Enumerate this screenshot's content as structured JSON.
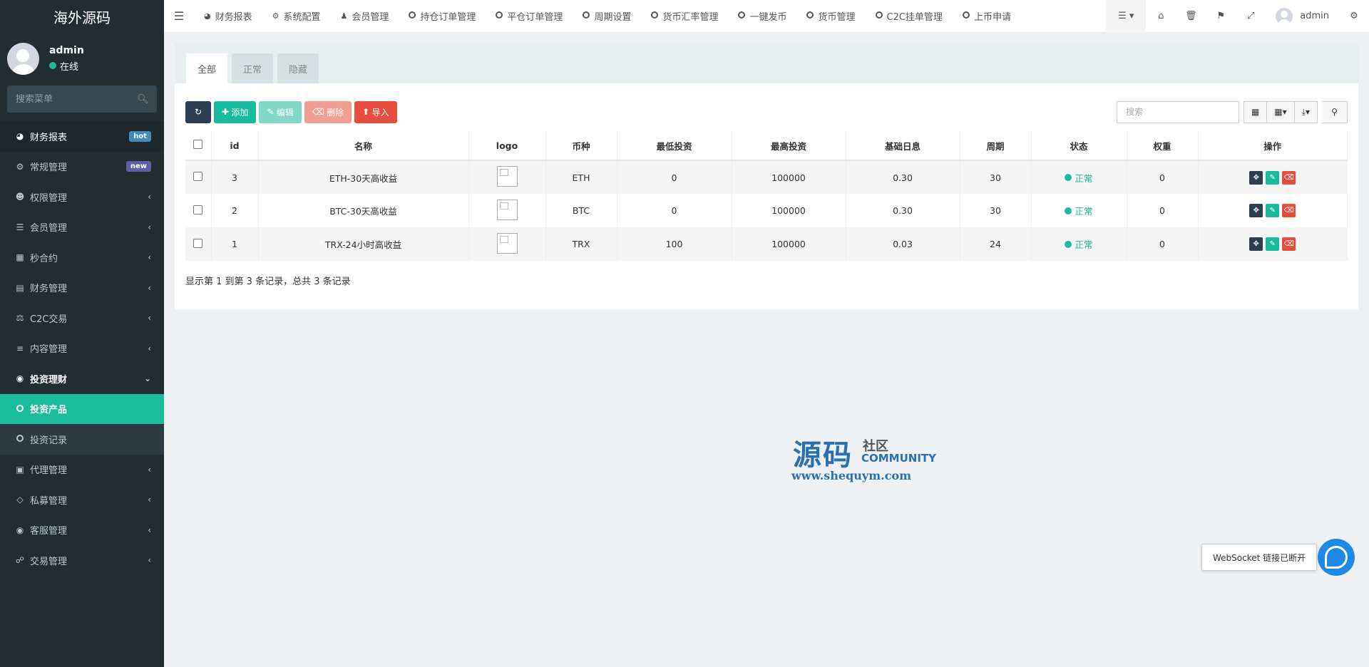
{
  "sidebar": {
    "brand": "海外源码",
    "user": {
      "name": "admin",
      "status": "在线"
    },
    "search_placeholder": "搜索菜单",
    "items": [
      {
        "label": "财务报表",
        "badge": "hot"
      },
      {
        "label": "常规管理",
        "badge": "new"
      },
      {
        "label": "权限管理"
      },
      {
        "label": "会员管理"
      },
      {
        "label": "秒合约"
      },
      {
        "label": "财务管理"
      },
      {
        "label": "C2C交易"
      },
      {
        "label": "内容管理"
      },
      {
        "label": "投资理财"
      },
      {
        "label": "投资产品"
      },
      {
        "label": "投资记录"
      },
      {
        "label": "代理管理"
      },
      {
        "label": "私募管理"
      },
      {
        "label": "客服管理"
      },
      {
        "label": "交易管理"
      }
    ]
  },
  "topbar": {
    "links": [
      "财务报表",
      "系统配置",
      "会员管理",
      "持仓订单管理",
      "平仓订单管理",
      "周期设置",
      "货币汇率管理",
      "一键发币",
      "货币管理",
      "C2C挂单管理",
      "上币申请"
    ],
    "user": "admin"
  },
  "tabs": [
    "全部",
    "正常",
    "隐藏"
  ],
  "toolbar": {
    "add": "添加",
    "edit": "编辑",
    "delete": "删除",
    "import": "导入",
    "search_placeholder": "搜索"
  },
  "table": {
    "headers": [
      "id",
      "名称",
      "logo",
      "币种",
      "最低投资",
      "最高投资",
      "基础日息",
      "周期",
      "状态",
      "权重",
      "操作"
    ],
    "rows": [
      {
        "id": "3",
        "name": "ETH-30天高收益",
        "coin": "ETH",
        "min": "0",
        "max": "100000",
        "rate": "0.30",
        "period": "30",
        "status": "正常",
        "weight": "0"
      },
      {
        "id": "2",
        "name": "BTC-30天高收益",
        "coin": "BTC",
        "min": "0",
        "max": "100000",
        "rate": "0.30",
        "period": "30",
        "status": "正常",
        "weight": "0"
      },
      {
        "id": "1",
        "name": "TRX-24小时高收益",
        "coin": "TRX",
        "min": "100",
        "max": "100000",
        "rate": "0.03",
        "period": "24",
        "status": "正常",
        "weight": "0"
      }
    ]
  },
  "pagination_info": "显示第 1 到第 3 条记录，总共 3 条记录",
  "watermark": {
    "main": "源码",
    "sub1": "社区",
    "sub2": "COMMUNITY",
    "url": "www.shequym.com"
  },
  "websocket": {
    "message": "WebSocket 链接已断开"
  },
  "colors": {
    "sidebar_bg": "#222d32",
    "accent": "#18bc9c",
    "danger": "#e74c3c",
    "dark": "#2c3e50"
  }
}
